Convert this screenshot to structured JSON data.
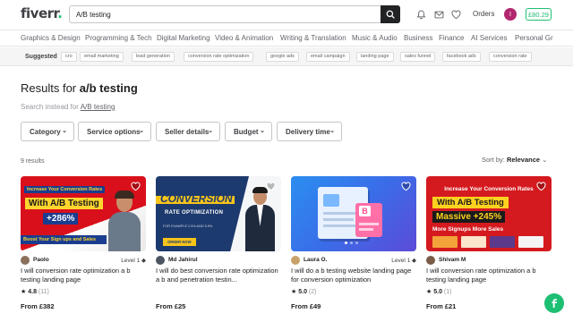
{
  "header": {
    "logo_text": "fiverr",
    "logo_dot": ".",
    "search": {
      "value": "A/B testing",
      "placeholder": ""
    },
    "orders_label": "Orders",
    "avatar_initial": "I",
    "balance": "£80.29",
    "icons": [
      "search-icon",
      "bell-icon",
      "mail-icon",
      "heart-icon"
    ]
  },
  "categories": [
    "Graphics & Design",
    "Programming & Tech",
    "Digital Marketing",
    "Video & Animation",
    "Writing & Translation",
    "Music & Audio",
    "Business",
    "Finance",
    "AI Services",
    "Personal Gr"
  ],
  "suggested": {
    "label": "Suggested",
    "chips": [
      "cro",
      "email marketing",
      "lead generation",
      "conversion rate optimization",
      "google ads",
      "email campaign",
      "landing page",
      "sales funnel",
      "facebook ads",
      "conversion rate"
    ]
  },
  "results": {
    "title_prefix": "Results for",
    "query": "a/b testing",
    "instead_prefix": "Search instead for",
    "instead_link": "A/B testing",
    "count": "9 results",
    "sort_label": "Sort by:",
    "sort_value": "Relevance"
  },
  "filters": [
    "Category",
    "Service options",
    "Seller details",
    "Budget",
    "Delivery time"
  ],
  "gigs": [
    {
      "seller": "Paolo",
      "level": "Level 1",
      "level_mark": "◆",
      "title": "I will conversion rate optimization a b testing landing page",
      "rating": "4.8",
      "reviews": "(11)",
      "price": "From £382",
      "thumb_lines": [
        "Increase Your Conversion Rates",
        "With A/B Testing",
        "+286%",
        "Boost Your Sign ups and Sales"
      ]
    },
    {
      "seller": "Md Jahirul",
      "level": "",
      "level_mark": "",
      "title": "I will do best conversion rate optimization a b and penetration testin...",
      "rating": "",
      "reviews": "",
      "price": "From £25",
      "thumb_lines": [
        "CONVERSION",
        "RATE OPTIMIZATION",
        "FOR EXAMPLE 2.5% AND 5.5%",
        "ORDER NOW"
      ]
    },
    {
      "seller": "Laura O.",
      "level": "Level 1",
      "level_mark": "◆",
      "title": "I will do a b testing website landing page for conversion optimization",
      "rating": "5.0",
      "reviews": "(2)",
      "price": "From £49",
      "thumb_lines": [
        "A",
        "B"
      ]
    },
    {
      "seller": "Shivam M",
      "level": "",
      "level_mark": "",
      "title": "I will conversion rate optimization a b testing landing page",
      "rating": "5.0",
      "reviews": "(1)",
      "price": "From £21",
      "thumb_lines": [
        "Increase Your Conversion Rates",
        "With A/B Testing",
        "Massive +245%",
        "More Signups More Sales"
      ]
    }
  ],
  "colors": {
    "brand": "#1dbf73",
    "text": "#222325",
    "muted": "#62646a",
    "border": "#c5c6c9"
  }
}
